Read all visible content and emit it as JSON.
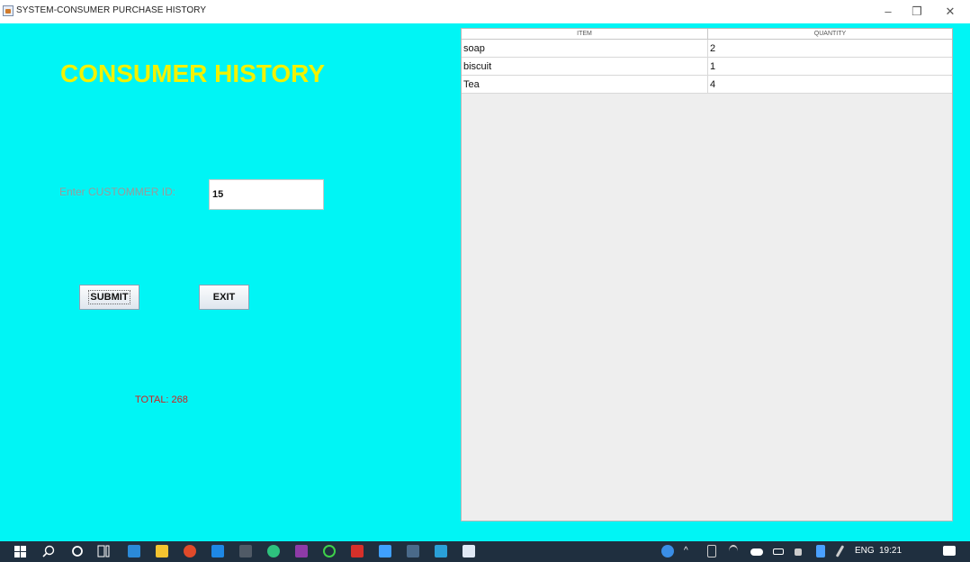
{
  "window": {
    "title": "SYSTEM-CONSUMER PURCHASE HISTORY",
    "controls": {
      "minimize": "–",
      "maximize": "❐",
      "close": "✕"
    }
  },
  "main": {
    "heading": "CONSUMER HISTORY",
    "id_label": "Enter CUSTOMMER ID:",
    "id_value": "15",
    "submit_label": "SUBMIT",
    "exit_label": "EXIT",
    "total_text": "TOTAL: 268"
  },
  "table": {
    "columns": [
      "ITEM",
      "QUANTITY"
    ],
    "rows": [
      {
        "item": "soap",
        "quantity": "2"
      },
      {
        "item": "biscuit",
        "quantity": "1"
      },
      {
        "item": "Tea",
        "quantity": "4"
      }
    ]
  },
  "taskbar": {
    "language": "ENG",
    "time": "19:21",
    "icons": [
      "windows-start-icon",
      "search-icon",
      "cortana-icon",
      "task-view-icon",
      "mail-icon",
      "file-explorer-icon",
      "chrome-icon",
      "vscode-icon",
      "terminal-icon",
      "app-icon",
      "onenote-icon",
      "green-circle-app-icon",
      "acrobat-icon",
      "box-app-icon",
      "photos-icon",
      "maps-icon",
      "java-app-icon"
    ]
  },
  "colors": {
    "background": "#00f5f5",
    "heading": "#f2f200",
    "total": "#d02020",
    "taskbar": "#1f2f3f"
  }
}
